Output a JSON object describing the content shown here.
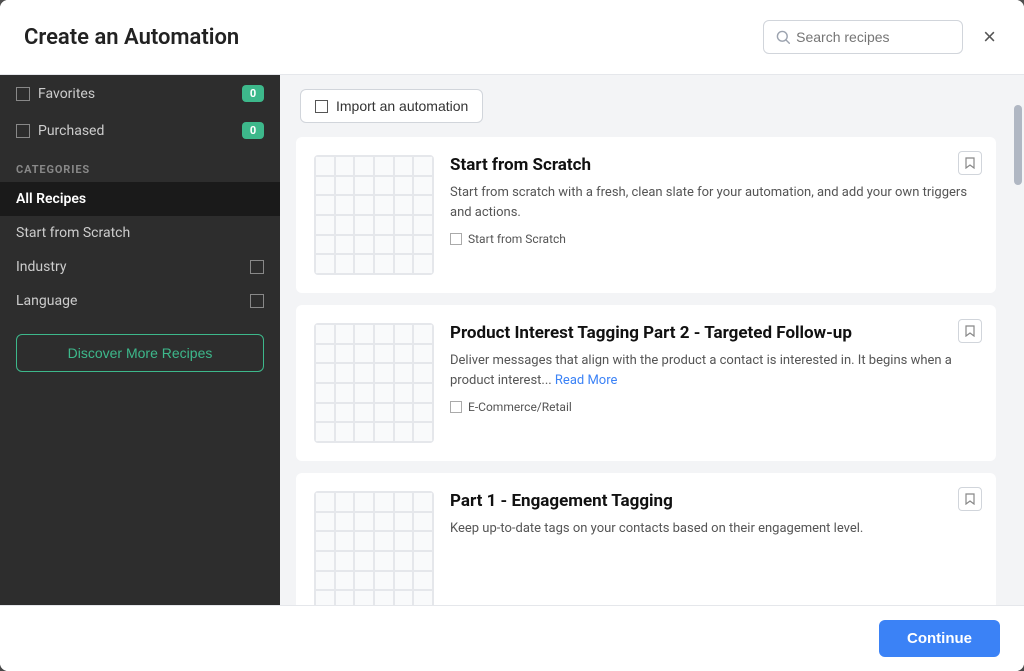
{
  "modal": {
    "title": "Create an Automation",
    "close_label": "×"
  },
  "search": {
    "placeholder": "Search recipes"
  },
  "sidebar": {
    "favorites_label": "Favorites",
    "favorites_count": "0",
    "purchased_label": "Purchased",
    "purchased_count": "0",
    "categories_heading": "CATEGORIES",
    "nav_items": [
      {
        "label": "All Recipes",
        "active": true
      },
      {
        "label": "Start from Scratch",
        "active": false
      },
      {
        "label": "Industry",
        "active": false,
        "expandable": true
      },
      {
        "label": "Language",
        "active": false,
        "expandable": true
      }
    ],
    "discover_btn_label": "Discover More Recipes"
  },
  "toolbar": {
    "import_btn_label": "Import an automation"
  },
  "recipes": [
    {
      "title": "Start from Scratch",
      "description": "Start from scratch with a fresh, clean slate for your automation, and add your own triggers and actions.",
      "tag": "Start from Scratch",
      "read_more": null
    },
    {
      "title": "Product Interest Tagging Part 2 - Targeted Follow-up",
      "description": "Deliver messages that align with the product a contact is interested in. It begins when a product interest...",
      "tag": "E-Commerce/Retail",
      "read_more": "Read More"
    },
    {
      "title": "Part 1 - Engagement Tagging",
      "description": "Keep up-to-date tags on your contacts based on their engagement level.",
      "tag": null,
      "read_more": null
    }
  ],
  "footer": {
    "continue_label": "Continue"
  }
}
